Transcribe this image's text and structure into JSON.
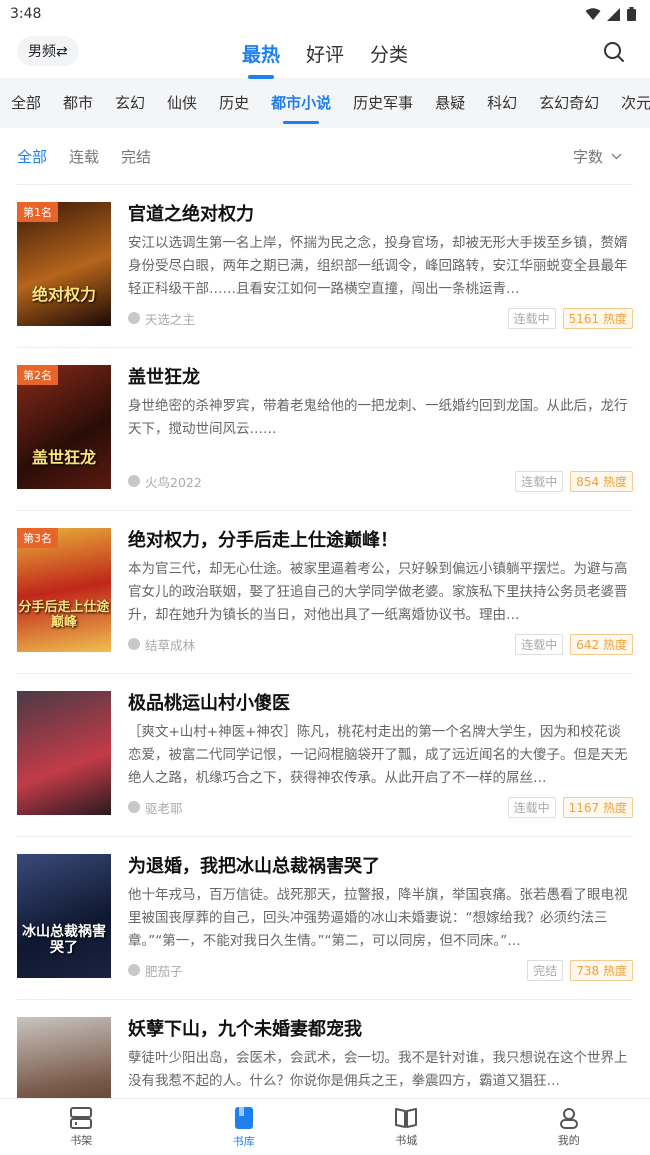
{
  "status_bar": {
    "time": "3:48"
  },
  "header": {
    "gender_switch": "男频⇄",
    "tabs": [
      {
        "label": "最热",
        "active": true
      },
      {
        "label": "好评",
        "active": false
      },
      {
        "label": "分类",
        "active": false
      }
    ],
    "search_icon": "search-icon"
  },
  "categories": [
    {
      "label": "全部",
      "active": false
    },
    {
      "label": "都市",
      "active": false
    },
    {
      "label": "玄幻",
      "active": false
    },
    {
      "label": "仙侠",
      "active": false
    },
    {
      "label": "历史",
      "active": false
    },
    {
      "label": "都市小说",
      "active": true
    },
    {
      "label": "历史军事",
      "active": false
    },
    {
      "label": "悬疑",
      "active": false
    },
    {
      "label": "科幻",
      "active": false
    },
    {
      "label": "玄幻奇幻",
      "active": false
    },
    {
      "label": "次元",
      "active": false
    }
  ],
  "filters": {
    "items": [
      {
        "label": "全部",
        "active": true
      },
      {
        "label": "连载",
        "active": false
      },
      {
        "label": "完结",
        "active": false
      }
    ],
    "sort_label": "字数"
  },
  "books": [
    {
      "rank": "第1名",
      "cover_text": "绝对权力",
      "title": "官道之绝对权力",
      "desc": "安江以选调生第一名上岸，怀揣为民之念，投身官场，却被无形大手拨至乡镇，赘婿身份受尽白眼，两年之期已满，组织部一纸调令，峰回路转，安江华丽蜕变全县最年轻正科级干部……且看安江如何一路横空直撞，闯出一条桃运青…",
      "author": "天选之主",
      "status": "连载中",
      "heat": "5161 热度",
      "colors": [
        "#3a1a08",
        "#b5641c"
      ]
    },
    {
      "rank": "第2名",
      "cover_text": "盖世狂龙",
      "title": "盖世狂龙",
      "desc": "身世绝密的杀神罗宾，带着老鬼给他的一把龙刺、一纸婚约回到龙国。从此后，龙行天下，搅动世间风云……",
      "author": "火鸟2022",
      "status": "连载中",
      "heat": "854 热度",
      "colors": [
        "#2a0d08",
        "#8a2a1a"
      ]
    },
    {
      "rank": "第3名",
      "cover_text": "分手后走上仕途巅峰",
      "title": "绝对权力，分手后走上仕途巅峰！",
      "desc": "本为官三代，却无心仕途。被家里逼着考公，只好躲到偏远小镇躺平摆烂。为避与高官女儿的政治联姻，娶了狂追自己的大学同学做老婆。家族私下里扶持公务员老婆晋升，却在她升为镇长的当日，对他出具了一纸离婚协议书。理由…",
      "author": "结草成林",
      "status": "连载中",
      "heat": "642 热度",
      "colors": [
        "#c0261a",
        "#e9b13a"
      ]
    },
    {
      "rank": "",
      "cover_text": "",
      "title": "极品桃运山村小傻医",
      "desc": "［爽文+山村+神医+神农］陈凡，桃花村走出的第一个名牌大学生，因为和校花谈恋爱，被富二代同学记恨，一记闷棍脑袋开了瓢，成了远近闻名的大傻子。但是天无绝人之路，机缘巧合之下，获得神农传承。从此开启了不一样的屌丝…",
      "author": "驱老耶",
      "status": "连载中",
      "heat": "1167 热度",
      "colors": [
        "#4a3a46",
        "#c33b48"
      ]
    },
    {
      "rank": "",
      "cover_text": "冰山总裁祸害哭了",
      "title": "为退婚，我把冰山总裁祸害哭了",
      "desc": "他十年戎马，百万信徒。战死那天，拉警报，降半旗，举国哀痛。张若愚看了眼电视里被国丧厚葬的自己，回头冲强势逼婚的冰山未婚妻说：“想嫁给我？必须约法三章。”“第一，不能对我日久生情。”“第二，可以同房，但不同床。”…",
      "author": "肥茄子",
      "status": "完结",
      "heat": "738 热度",
      "colors": [
        "#0f1830",
        "#3a4a7a"
      ]
    },
    {
      "rank": "",
      "cover_text": "",
      "title": "妖孽下山，九个未婚妻都宠我",
      "desc": "孽徒叶少阳出岛，会医术，会武术，会一切。我不是针对谁，我只想说在这个世界上没有我惹不起的人。什么？你说你是佣兵之王，拳震四方，霸道又猖狂…",
      "author": "",
      "status": "",
      "heat": "",
      "colors": [
        "#c9c4c0",
        "#7a5a4a"
      ]
    }
  ],
  "bottom_nav": [
    {
      "label": "书架",
      "icon": "bookshelf-icon",
      "active": false
    },
    {
      "label": "书库",
      "icon": "library-icon",
      "active": true
    },
    {
      "label": "书城",
      "icon": "bookstore-icon",
      "active": false
    },
    {
      "label": "我的",
      "icon": "profile-icon",
      "active": false
    }
  ]
}
